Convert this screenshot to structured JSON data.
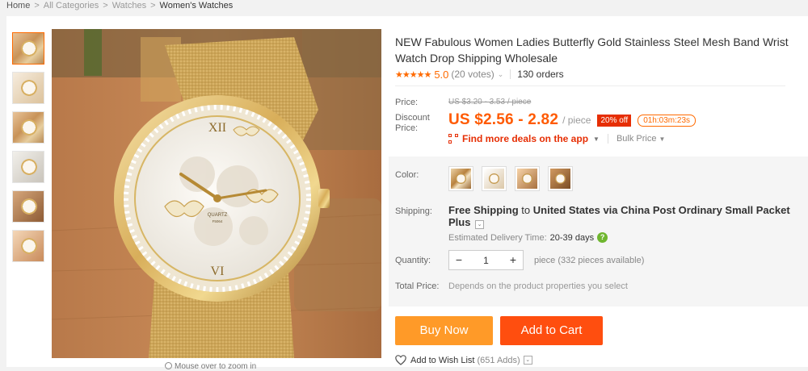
{
  "breadcrumb": [
    {
      "label": "Home"
    },
    {
      "label": "All Categories"
    },
    {
      "label": "Watches"
    },
    {
      "label": "Women's Watches"
    }
  ],
  "breadcrumb_separator": ">",
  "gallery": {
    "thumbnails": [
      "thumbnail-1",
      "thumbnail-2",
      "thumbnail-3",
      "thumbnail-4",
      "thumbnail-5",
      "thumbnail-6"
    ],
    "zoom_hint": "Mouse over to zoom in",
    "dial_text": "QUARTZ",
    "dial_subtext": "F5064"
  },
  "product": {
    "title": "NEW Fabulous Women Ladies Butterfly Gold Stainless Steel Mesh Band Wrist Watch Drop Shipping Wholesale",
    "stars": "★★★★★",
    "rating": "5.0",
    "votes": "(20 votes)",
    "orders": "130 orders"
  },
  "price": {
    "label": "Price:",
    "original": "US $3.20 - 3.53 / piece",
    "discount_label": "Discount Price:",
    "discount": "US $2.56 - 2.82",
    "unit": "/ piece",
    "off_badge": "20% off",
    "timer": "01h:03m:23s",
    "deals_link": "Find more deals on the app",
    "bulk_price": "Bulk Price"
  },
  "color": {
    "label": "Color:",
    "swatch_count": 4
  },
  "shipping": {
    "label": "Shipping:",
    "free": "Free Shipping",
    "to": "to",
    "destination": "United States via China Post Ordinary Small Packet Plus",
    "delivery_label": "Estimated Delivery Time:",
    "delivery_days": "20-39 days"
  },
  "quantity": {
    "label": "Quantity:",
    "minus": "−",
    "value": "1",
    "plus": "+",
    "available": "piece (332 pieces available)"
  },
  "total": {
    "label": "Total Price:",
    "value": "Depends on the product properties you select"
  },
  "actions": {
    "buy_now": "Buy Now",
    "add_to_cart": "Add to Cart",
    "wish_list": "Add to Wish List",
    "wish_adds": "(651 Adds)"
  },
  "colors": {
    "accent": "#ff6a00",
    "price_red": "#ff5a00",
    "buy_now_bg": "#ff9a28",
    "add_to_cart_bg": "#ff4e0f",
    "badge_bg": "#e62e04"
  }
}
